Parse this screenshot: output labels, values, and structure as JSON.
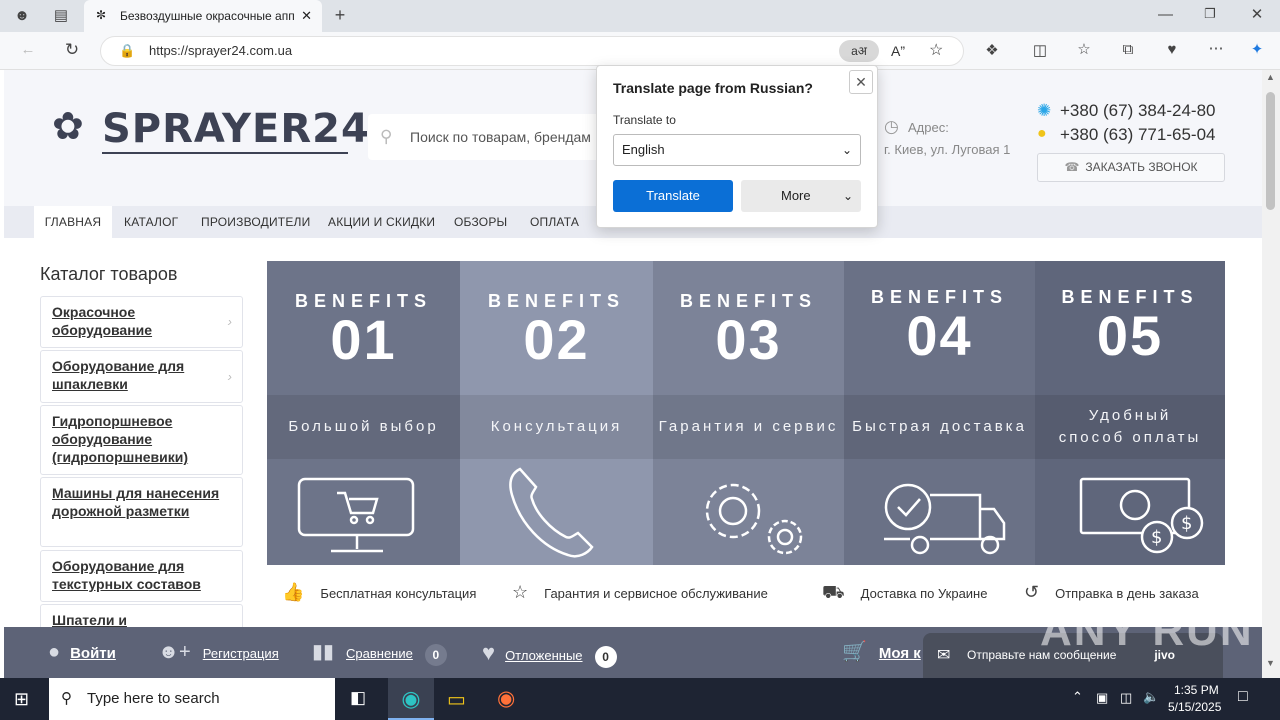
{
  "browser": {
    "tab_title": "Безвоздушные окрасочные апп",
    "url": "https://sprayer24.com.ua"
  },
  "header": {
    "logo_text": "SPRAYER24",
    "search_placeholder": "Поиск по товарам, брендам",
    "address_label": "Адрес:",
    "address_value": "г. Киев, ул. Луговая 1",
    "phone1": "+380 (67) 384-24-80",
    "phone2": "+380 (63) 771-65-04",
    "call_button": "ЗАКАЗАТЬ ЗВОНОК"
  },
  "nav": [
    "ГЛАВНАЯ",
    "КАТАЛОГ",
    "ПРОИЗВОДИТЕЛИ",
    "АКЦИИ И СКИДКИ",
    "ОБЗОРЫ",
    "ОПЛАТА"
  ],
  "catalog": {
    "title": "Каталог товаров",
    "items": [
      "Окрасочное оборудование",
      "Оборудование для шпаклевки",
      "Гидропоршневое оборудование (гидропоршневики)",
      "Машины для нанесения дорожной разметки",
      "Оборудование для текстурных составов",
      "Шпатели и"
    ]
  },
  "banner": [
    {
      "word": "BENEFITS",
      "num": "01",
      "label": "Большой выбор",
      "icon": "monitor-cart-icon"
    },
    {
      "word": "BENEFITS",
      "num": "02",
      "label": "Консультация",
      "icon": "phone-icon"
    },
    {
      "word": "BENEFITS",
      "num": "03",
      "label": "Гарантия и сервис",
      "icon": "gears-icon"
    },
    {
      "word": "BENEFITS",
      "num": "04",
      "label": "Быстрая доставка",
      "icon": "truck-icon"
    },
    {
      "word": "BENEFITS",
      "num": "05",
      "label": "Удобный способ оплаты",
      "icon": "money-icon"
    }
  ],
  "features": [
    "Бесплатная консультация",
    "Гарантия и сервисное обслуживание",
    "Доставка по Украине",
    "Отправка в день заказа"
  ],
  "bottom_bar": {
    "login": "Войти",
    "register": "Регистрация",
    "compare": "Сравнение",
    "compare_count": "0",
    "wishlist": "Отложенные",
    "wishlist_count": "0",
    "cart": "Моя к",
    "chat": "Отправьте нам сообщение",
    "chat_brand": "jivo"
  },
  "translate_popup": {
    "title": "Translate page from Russian?",
    "translate_to_label": "Translate to",
    "language": "English",
    "translate_button": "Translate",
    "more_button": "More"
  },
  "taskbar": {
    "search_placeholder": "Type here to search",
    "time": "1:35 PM",
    "date": "5/15/2025"
  },
  "watermark": "ANY RUN",
  "colors": {
    "accent_blue": "#0b6fd6",
    "bottom_bar": "#5d6377",
    "taskbar": "#1e2433"
  }
}
